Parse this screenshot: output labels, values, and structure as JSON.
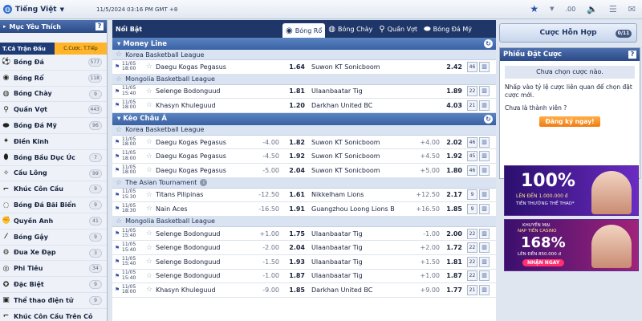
{
  "topbar": {
    "language": "Tiếng Việt",
    "datetime": "11/5/2024 03:16 PM GMT +8",
    "odds_format": ".00"
  },
  "left": {
    "favorites_title": "Mục Yêu Thích",
    "sports_title_left": "T.Cả Trận Đấu",
    "sports_title_right": "C.Cược. T.Tiếp",
    "sports": [
      {
        "name": "Bóng Đá",
        "count": "577",
        "icon": "soccer-ball-icon"
      },
      {
        "name": "Bóng Rổ",
        "count": "118",
        "icon": "basketball-icon"
      },
      {
        "name": "Bóng Chày",
        "count": "9",
        "icon": "baseball-icon"
      },
      {
        "name": "Quần Vợt",
        "count": "443",
        "icon": "tennis-icon"
      },
      {
        "name": "Bóng Đá Mỹ",
        "count": "96",
        "icon": "american-football-icon"
      },
      {
        "name": "Điền Kinh",
        "count": "",
        "icon": "athletics-icon"
      },
      {
        "name": "Bóng Bầu Dục Úc",
        "count": "7",
        "icon": "aussie-rules-icon"
      },
      {
        "name": "Cầu Lông",
        "count": "99",
        "icon": "badminton-icon"
      },
      {
        "name": "Khúc Côn Cầu",
        "count": "9",
        "icon": "hockey-icon"
      },
      {
        "name": "Bóng Đá Bãi Biển",
        "count": "9",
        "icon": "beach-soccer-icon"
      },
      {
        "name": "Quyền Anh",
        "count": "41",
        "icon": "boxing-icon"
      },
      {
        "name": "Bóng Gậy",
        "count": "9",
        "icon": "cricket-icon"
      },
      {
        "name": "Đua Xe Đạp",
        "count": "3",
        "icon": "cycling-icon"
      },
      {
        "name": "Phi Tiêu",
        "count": "34",
        "icon": "darts-icon"
      },
      {
        "name": "Đặc Biệt",
        "count": "9",
        "icon": "special-icon"
      },
      {
        "name": "Thể thao điện tử",
        "count": "9",
        "icon": "esports-icon"
      },
      {
        "name": "Khúc Côn Cầu Trên Cỏ",
        "count": "",
        "icon": "field-hockey-icon"
      }
    ]
  },
  "sport_tabs": {
    "featured": "Nổi Bật",
    "tabs": [
      {
        "label": "Bóng Rổ",
        "selected": true
      },
      {
        "label": "Bóng Chày",
        "selected": false
      },
      {
        "label": "Quần Vợt",
        "selected": false
      },
      {
        "label": "Bóng Đá Mỹ",
        "selected": false
      }
    ]
  },
  "sections": [
    {
      "title": "Money Line",
      "leagues": [
        {
          "name": "Korea Basketball League",
          "rows": [
            {
              "date": "11/05",
              "time": "18:00",
              "home": "Daegu Kogas Pegasus",
              "hcap": "",
              "hodds": "1.64",
              "away": "Suwon KT Sonicboom",
              "acap": "",
              "aodds": "2.42",
              "markets": "46"
            }
          ]
        },
        {
          "name": "Mongolia Basketball League",
          "rows": [
            {
              "date": "11/05",
              "time": "15:40",
              "home": "Selenge Bodonguud",
              "hcap": "",
              "hodds": "1.81",
              "away": "Ulaanbaatar Tig",
              "acap": "",
              "aodds": "1.89",
              "markets": "22"
            },
            {
              "date": "11/05",
              "time": "18:00",
              "home": "Khasyn Khuleguud",
              "hcap": "",
              "hodds": "1.20",
              "away": "Darkhan United BC",
              "acap": "",
              "aodds": "4.03",
              "markets": "21"
            }
          ]
        }
      ]
    },
    {
      "title": "Kèo Châu Á",
      "leagues": [
        {
          "name": "Korea Basketball League",
          "rows": [
            {
              "date": "11/05",
              "time": "18:00",
              "home": "Daegu Kogas Pegasus",
              "hcap": "-4.00",
              "hodds": "1.82",
              "away": "Suwon KT Sonicboom",
              "acap": "+4.00",
              "aodds": "2.02",
              "markets": "46"
            },
            {
              "date": "11/05",
              "time": "18:00",
              "home": "Daegu Kogas Pegasus",
              "hcap": "-4.50",
              "hodds": "1.92",
              "away": "Suwon KT Sonicboom",
              "acap": "+4.50",
              "aodds": "1.92",
              "markets": "45"
            },
            {
              "date": "11/05",
              "time": "18:00",
              "home": "Daegu Kogas Pegasus",
              "hcap": "-5.00",
              "hodds": "2.04",
              "away": "Suwon KT Sonicboom",
              "acap": "+5.00",
              "aodds": "1.80",
              "markets": "46"
            }
          ]
        },
        {
          "name": "The Asian Tournament",
          "rows": [
            {
              "date": "11/05",
              "time": "15:30",
              "home": "Titans Pilipinas",
              "hcap": "-12.50",
              "hodds": "1.61",
              "away": "Nikkelham Lions",
              "acap": "+12.50",
              "aodds": "2.17",
              "markets": "9"
            },
            {
              "date": "11/05",
              "time": "18:30",
              "home": "Nain Aces",
              "hcap": "-16.50",
              "hodds": "1.91",
              "away": "Guangzhou Loong Lions B",
              "acap": "+16.50",
              "aodds": "1.85",
              "markets": "9"
            }
          ]
        },
        {
          "name": "Mongolia Basketball League",
          "rows": [
            {
              "date": "11/05",
              "time": "15:40",
              "home": "Selenge Bodonguud",
              "hcap": "+1.00",
              "hodds": "1.75",
              "away": "Ulaanbaatar Tig",
              "acap": "-1.00",
              "aodds": "2.00",
              "markets": "22"
            },
            {
              "date": "11/05",
              "time": "15:40",
              "home": "Selenge Bodonguud",
              "hcap": "-2.00",
              "hodds": "2.04",
              "away": "Ulaanbaatar Tig",
              "acap": "+2.00",
              "aodds": "1.72",
              "markets": "22"
            },
            {
              "date": "11/05",
              "time": "15:40",
              "home": "Selenge Bodonguud",
              "hcap": "-1.50",
              "hodds": "1.93",
              "away": "Ulaanbaatar Tig",
              "acap": "+1.50",
              "aodds": "1.81",
              "markets": "22"
            },
            {
              "date": "11/05",
              "time": "15:40",
              "home": "Selenge Bodonguud",
              "hcap": "-1.00",
              "hodds": "1.87",
              "away": "Ulaanbaatar Tig",
              "acap": "+1.00",
              "aodds": "1.87",
              "markets": "22"
            },
            {
              "date": "11/05",
              "time": "18:00",
              "home": "Khasyn Khuleguud",
              "hcap": "-9.00",
              "hodds": "1.85",
              "away": "Darkhan United BC",
              "acap": "+9.00",
              "aodds": "1.77",
              "markets": "21"
            }
          ]
        }
      ]
    }
  ],
  "right": {
    "combo_label": "Cược Hỗn Hợp",
    "combo_count": "0/11",
    "slip_title": "Phiếu Đặt Cược",
    "no_selection": "Chưa chọn cược nào.",
    "slip_text": "Nhấp vào tỷ lệ cược liên quan để chọn đặt cược mới.",
    "not_member": "Chưa là thành viên ?",
    "register": "Đăng ký ngay!",
    "banner1": {
      "big": "100%",
      "line1": "LÊN ĐẾN 1.000.000 đ",
      "line2": "TIỀN THƯỞNG THỂ THAO*"
    },
    "banner2": {
      "line1": "KHUYẾN MẠI",
      "line2": "NẠP TIỀN CASINO",
      "big": "168%",
      "line3": "LÊN ĐẾN 850.000 đ",
      "cta": "NHẬN NGAY"
    }
  }
}
